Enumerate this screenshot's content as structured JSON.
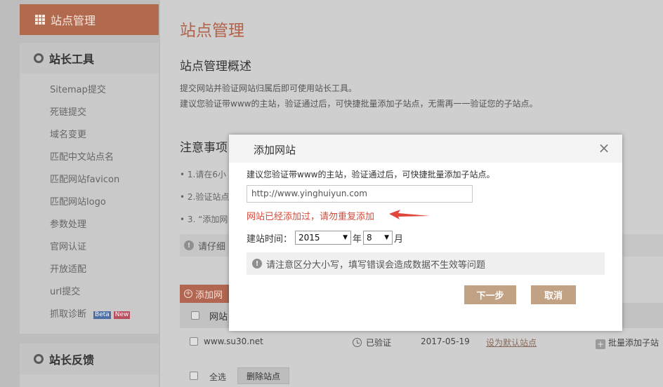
{
  "sidebar": {
    "active_item": "站点管理",
    "tools_title": "站长工具",
    "items": [
      {
        "label": "Sitemap提交"
      },
      {
        "label": "死链提交"
      },
      {
        "label": "域名变更"
      },
      {
        "label": "匹配中文站点名"
      },
      {
        "label": "匹配网站favicon"
      },
      {
        "label": "匹配网站logo"
      },
      {
        "label": "参数处理"
      },
      {
        "label": "官网认证"
      },
      {
        "label": "开放适配"
      },
      {
        "label": "url提交"
      },
      {
        "label": "抓取诊断"
      }
    ],
    "badges": {
      "beta": "Beta",
      "new": "New"
    },
    "feedback_title": "站长反馈"
  },
  "main": {
    "page_title": "站点管理",
    "overview_title": "站点管理概述",
    "desc1": "提交网站并验证网站归属后即可使用站长工具。",
    "desc2": "建议您验证带www的主站，验证通过后，可快捷批量添加子站点，无需再一一验证您的子站点。",
    "notice_title": "注意事项",
    "notes": [
      "1.请在6小",
      "2.验证站点",
      "3. “添加网"
    ],
    "warn_partial": "请仔细",
    "add_site_partial": "添加网",
    "table_header_site": "网站",
    "row": {
      "site": "www.su30.net",
      "status": "已验证",
      "date": "2017-05-19",
      "set_default": "设为默认站点",
      "batch_add": "批量添加子站"
    },
    "select_all": "全选",
    "delete_site": "删除站点"
  },
  "modal": {
    "title": "添加网站",
    "close": "×",
    "hint": "建议您验证带www的主站，验证通过后，可快捷批量添加子站点。",
    "url_value": "http://www.yinghuiyun.com",
    "error": "网站已经添加过，请勿重复添加",
    "date_label": "建站时间：",
    "year": "2015",
    "year_unit": "年",
    "month": "8",
    "month_unit": "月",
    "warning": "请注意区分大小写，填写错误会造成数据不生效等问题",
    "next": "下一步",
    "cancel": "取消"
  },
  "colors": {
    "accent": "#b26a4f",
    "error": "#d44a3a",
    "modal_button": "#c1a285"
  }
}
